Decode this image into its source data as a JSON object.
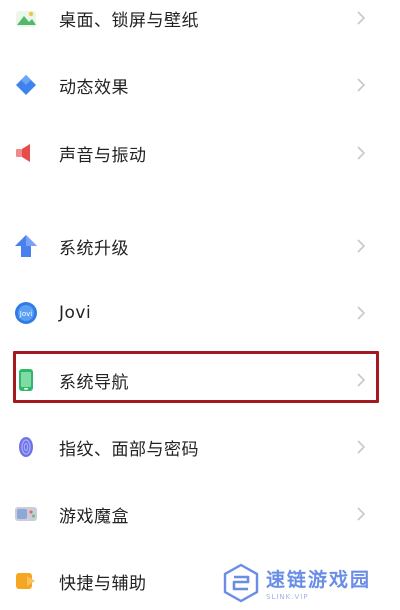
{
  "settings": {
    "items": [
      {
        "label": "桌面、锁屏与壁纸",
        "icon": "wallpaper-icon"
      },
      {
        "label": "动态效果",
        "icon": "dynamic-effect-icon"
      },
      {
        "label": "声音与振动",
        "icon": "sound-icon"
      },
      {
        "label": "系统升级",
        "icon": "system-upgrade-icon"
      },
      {
        "label": "Jovi",
        "icon": "jovi-icon"
      },
      {
        "label": "系统导航",
        "icon": "system-navigation-icon"
      },
      {
        "label": "指纹、面部与密码",
        "icon": "fingerprint-icon"
      },
      {
        "label": "游戏魔盒",
        "icon": "game-box-icon"
      },
      {
        "label": "快捷与辅助",
        "icon": "shortcut-icon"
      }
    ],
    "highlighted_item": "系统导航"
  },
  "watermark": {
    "title": "速链游戏园",
    "subtitle": "SLINK.VIP"
  },
  "colors": {
    "highlight_border": "#a21a1f",
    "chevron": "#c8c8c8",
    "text": "#222222"
  }
}
